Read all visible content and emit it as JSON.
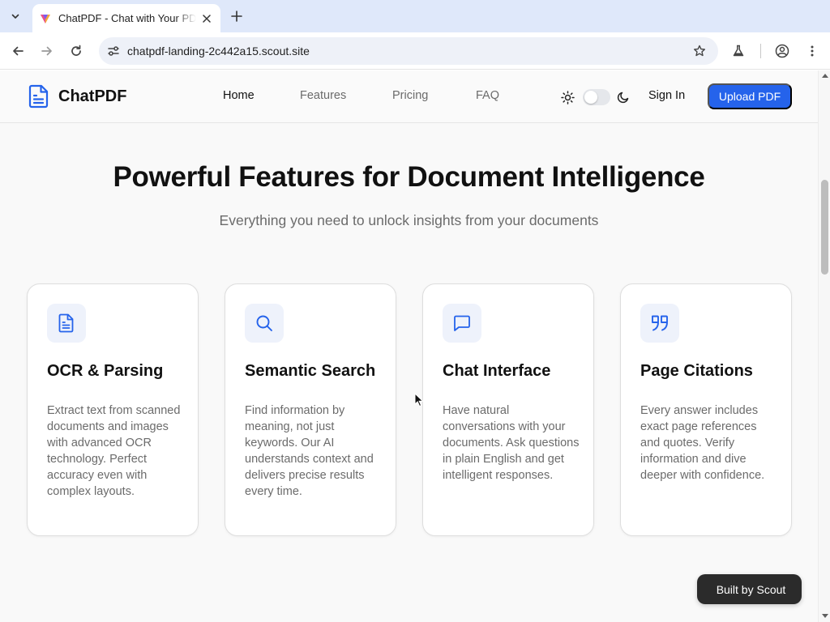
{
  "browser": {
    "tab_title": "ChatPDF - Chat with Your PDF",
    "url": "chatpdf-landing-2c442a15.scout.site"
  },
  "site": {
    "brand": "ChatPDF",
    "nav": {
      "home": "Home",
      "features": "Features",
      "pricing": "Pricing",
      "faq": "FAQ"
    },
    "theme_toggle": {
      "mode": "light"
    },
    "sign_in": "Sign In",
    "upload": "Upload PDF",
    "accent_color": "#2563eb"
  },
  "features": {
    "title": "Powerful Features for Document Intelligence",
    "subtitle": "Everything you need to unlock insights from your documents",
    "cards": [
      {
        "icon": "document-icon",
        "title": "OCR & Parsing",
        "description": "Extract text from scanned documents and images with advanced OCR technology. Perfect accuracy even with complex layouts."
      },
      {
        "icon": "search-icon",
        "title": "Semantic Search",
        "description": "Find information by meaning, not just keywords. Our AI understands context and delivers precise results every time."
      },
      {
        "icon": "chat-bubble-icon",
        "title": "Chat Interface",
        "description": "Have natural conversations with your documents. Ask questions in plain English and get intelligent responses."
      },
      {
        "icon": "quote-icon",
        "title": "Page Citations",
        "description": "Every answer includes exact page references and quotes. Verify information and dive deeper with confidence."
      }
    ]
  },
  "badge": {
    "label": "Built by Scout",
    "icon": "scout-icon"
  }
}
